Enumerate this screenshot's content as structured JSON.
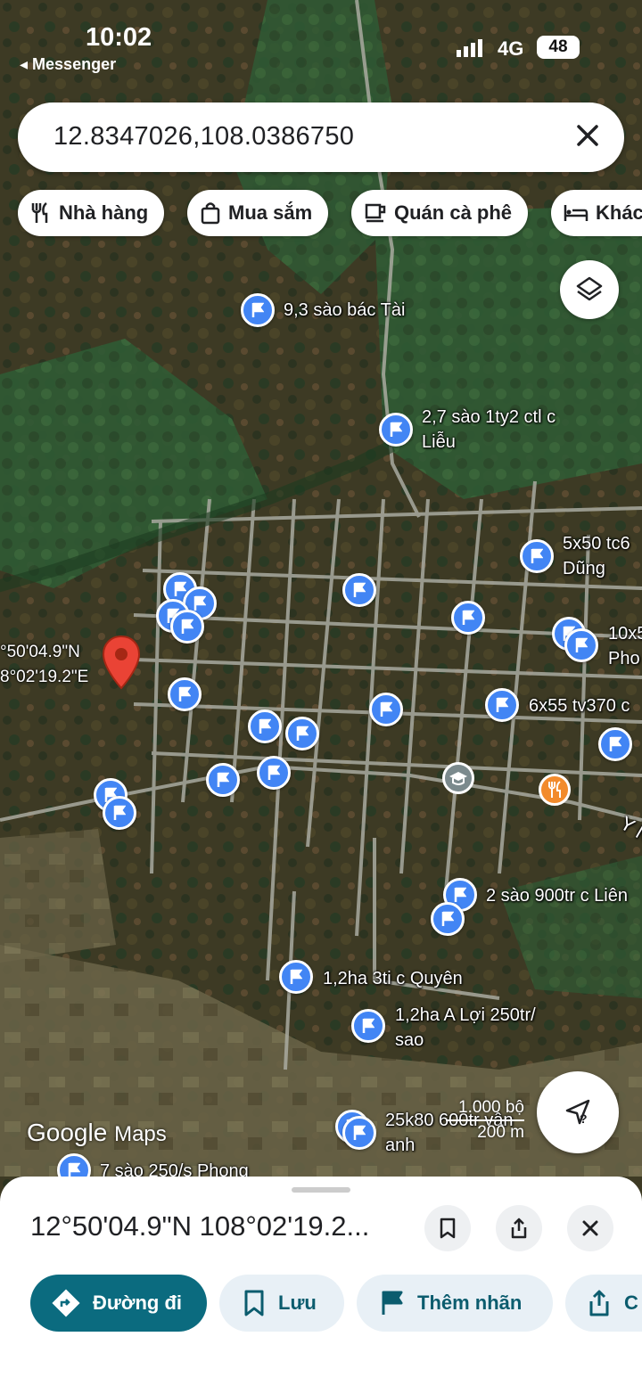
{
  "status_bar": {
    "time": "10:02",
    "back_app": "◂ Messenger",
    "network": "4G",
    "battery": "48"
  },
  "search": {
    "query": "12.8347026,108.0386750"
  },
  "chips": [
    {
      "label": "Nhà hàng",
      "icon": "fork-knife-icon"
    },
    {
      "label": "Mua sắm",
      "icon": "shopping-bag-icon"
    },
    {
      "label": "Quán cà phê",
      "icon": "coffee-cup-icon"
    },
    {
      "label": "Khác",
      "icon": "bed-icon"
    }
  ],
  "map": {
    "labels": {
      "l1": "9,3 sào bác Tài",
      "l2a": "2,7 sào 1ty2 ctl c",
      "l2b": "Liễu",
      "l3a": "5x50 tc6",
      "l3b": "Dũng",
      "l4a": "10x5",
      "l4b": "Pho",
      "l5": "6x55 tv370 c",
      "l6": "2 sào 900tr c Liên",
      "l7": "1,2ha 3ti c Quyên",
      "l8a": "1,2ha A Lợi 250tr/",
      "l8b": "sao",
      "l9a": "25k80 600tr vân",
      "l9b": "anh",
      "l10": "7 sào 250/s Phong",
      "road": "Y Ng"
    },
    "dropped_pin": {
      "lat_text": "°50'04.9\"N",
      "lng_text": "8°02'19.2\"E"
    },
    "logo": {
      "brand": "Google",
      "product": "Maps"
    },
    "scale": {
      "feet": "1.000 bộ",
      "meters": "200 m"
    }
  },
  "sheet": {
    "title": "12°50'04.9\"N 108°02'19.2...",
    "actions": [
      {
        "label": "Đường đi",
        "icon": "directions-icon"
      },
      {
        "label": "Lưu",
        "icon": "bookmark-icon"
      },
      {
        "label": "Thêm nhãn",
        "icon": "flag-icon"
      },
      {
        "label": "C",
        "icon": "share-icon"
      }
    ]
  },
  "colors": {
    "accent_teal": "#0b6b7f",
    "pin_blue": "#4285f4",
    "pin_red": "#ea4335",
    "chip_bg": "#e8f0f6"
  }
}
